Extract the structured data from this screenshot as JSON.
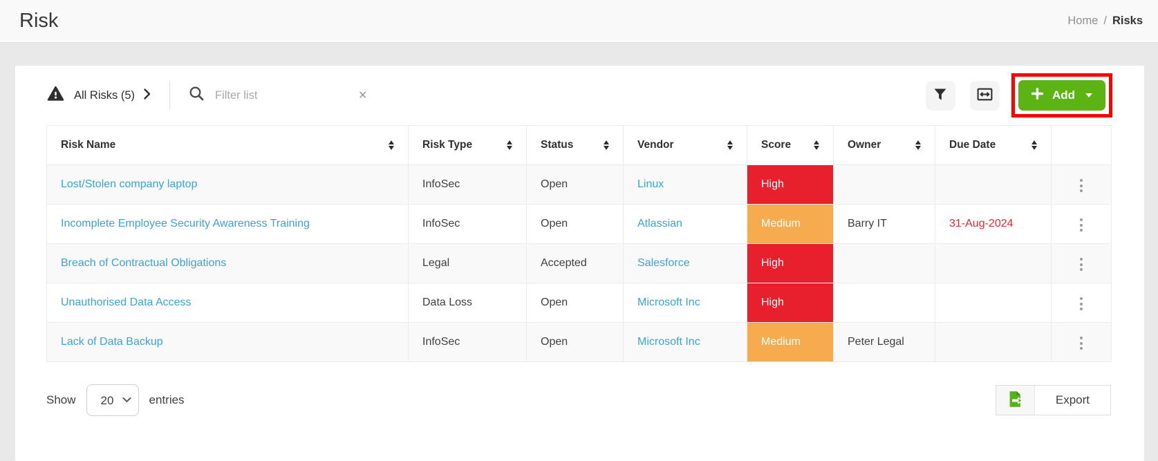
{
  "topbar": {
    "title": "Risk",
    "breadcrumb": {
      "home": "Home",
      "separator": "/",
      "current": "Risks"
    }
  },
  "toolbar": {
    "view_selector": {
      "label": "All Risks (5)"
    },
    "filter": {
      "placeholder": "Filter list",
      "value": "",
      "clear_glyph": "✕"
    },
    "add_button": {
      "label": "Add"
    }
  },
  "table": {
    "columns": [
      {
        "label": "Risk Name",
        "sortable": true
      },
      {
        "label": "Risk Type",
        "sortable": true
      },
      {
        "label": "Status",
        "sortable": true
      },
      {
        "label": "Vendor",
        "sortable": true
      },
      {
        "label": "Score",
        "sortable": true
      },
      {
        "label": "Owner",
        "sortable": true
      },
      {
        "label": "Due Date",
        "sortable": true
      },
      {
        "label": "",
        "sortable": false
      }
    ],
    "rows": [
      {
        "risk_name": "Lost/Stolen company laptop",
        "risk_type": "InfoSec",
        "status": "Open",
        "vendor": "Linux",
        "score": "High",
        "score_level": "high",
        "owner": "",
        "due_date": "",
        "due_date_overdue": false
      },
      {
        "risk_name": "Incomplete Employee Security Awareness Training",
        "risk_type": "InfoSec",
        "status": "Open",
        "vendor": "Atlassian",
        "score": "Medium",
        "score_level": "medium",
        "owner": "Barry IT",
        "due_date": "31-Aug-2024",
        "due_date_overdue": true
      },
      {
        "risk_name": "Breach of Contractual Obligations",
        "risk_type": "Legal",
        "status": "Accepted",
        "vendor": "Salesforce",
        "score": "High",
        "score_level": "high",
        "owner": "",
        "due_date": "",
        "due_date_overdue": false
      },
      {
        "risk_name": "Unauthorised Data Access",
        "risk_type": "Data Loss",
        "status": "Open",
        "vendor": "Microsoft Inc",
        "score": "High",
        "score_level": "high",
        "owner": "",
        "due_date": "",
        "due_date_overdue": false
      },
      {
        "risk_name": "Lack of Data Backup",
        "risk_type": "InfoSec",
        "status": "Open",
        "vendor": "Microsoft Inc",
        "score": "Medium",
        "score_level": "medium",
        "owner": "Peter Legal",
        "due_date": "",
        "due_date_overdue": false
      }
    ]
  },
  "footer": {
    "show_label": "Show",
    "page_size": "20",
    "entries_label": "entries",
    "export_button": {
      "label": "Export"
    }
  },
  "colors": {
    "score_high": "#e8202d",
    "score_medium": "#f6ab4f",
    "link_blue": "#3aa3da",
    "add_green": "#5cb414",
    "overdue_red": "#ee2430",
    "highlight_red": "#fe0000",
    "page_background": "#e9e9e9"
  },
  "icons": {
    "view_selector": "warning-triangle-icon",
    "view_chevron": "chevron-right-icon",
    "search": "search-icon",
    "clear_filter": "clear-icon",
    "filter": "filter-funnel-icon",
    "column_width": "column-width-icon",
    "add_plus": "plus-icon",
    "add_caret": "caret-down-icon",
    "sort": "sort-arrows-icon",
    "row_menu": "kebab-menu-icon",
    "page_size_caret": "chevron-down-icon",
    "export": "export-file-icon"
  }
}
